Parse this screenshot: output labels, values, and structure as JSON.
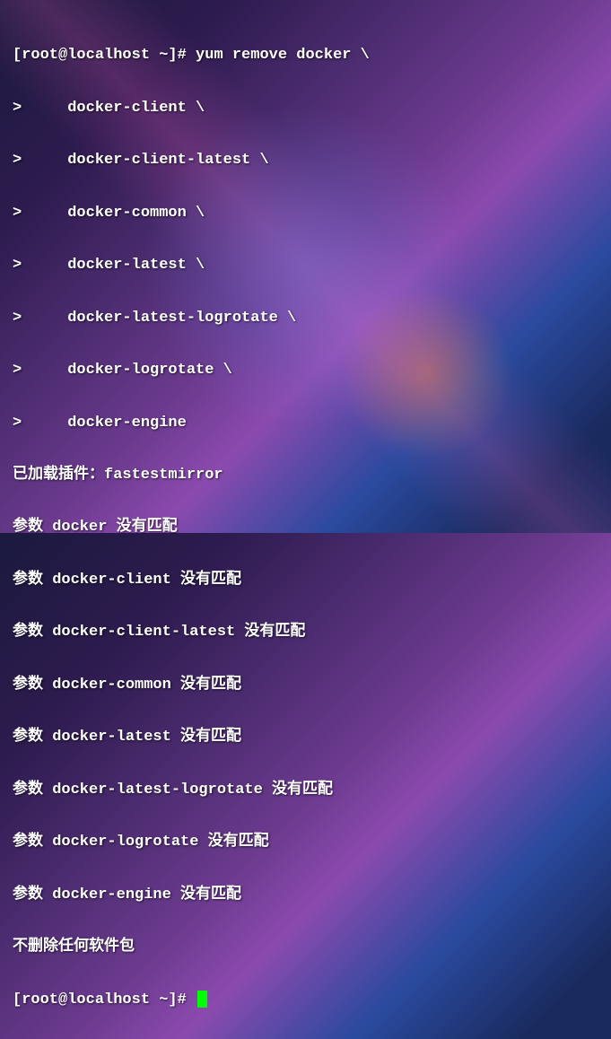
{
  "prompt1": "[root@localhost ~]# ",
  "command1": "yum remove docker \\",
  "cont_lines": [
    ">     docker-client \\",
    ">     docker-client-latest \\",
    ">     docker-common \\",
    ">     docker-latest \\",
    ">     docker-latest-logrotate \\",
    ">     docker-logrotate \\",
    ">     docker-engine"
  ],
  "output_lines": [
    "已加载插件：fastestmirror",
    "参数 docker 没有匹配",
    "参数 docker-client 没有匹配",
    "参数 docker-client-latest 没有匹配",
    "参数 docker-common 没有匹配",
    "参数 docker-latest 没有匹配",
    "参数 docker-latest-logrotate 没有匹配",
    "参数 docker-logrotate 没有匹配",
    "参数 docker-engine 没有匹配",
    "不删除任何软件包"
  ],
  "prompt2": "[root@localhost ~]#"
}
